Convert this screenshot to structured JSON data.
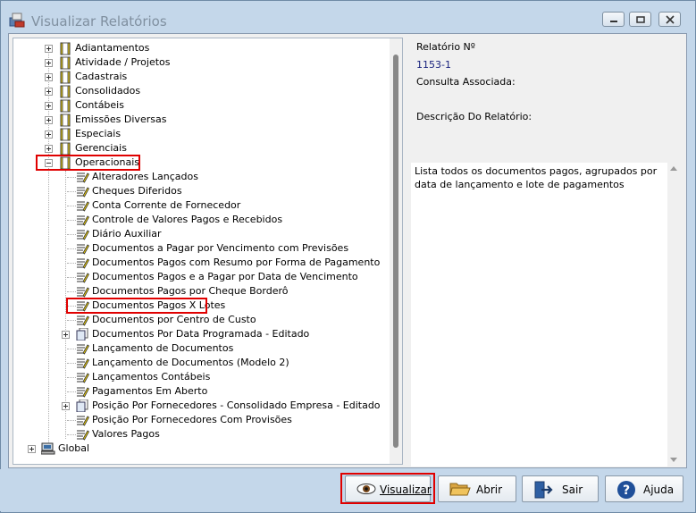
{
  "window": {
    "title": "Visualizar Relatórios"
  },
  "tree": {
    "categories": [
      "Adiantamentos",
      "Atividade / Projetos",
      "Cadastrais",
      "Consolidados",
      "Contábeis",
      "Emissões Diversas",
      "Especiais",
      "Gerenciais",
      "Operacionais"
    ],
    "reports": [
      "Alteradores Lançados",
      "Cheques Diferidos",
      "Conta Corrente de Fornecedor",
      "Controle de Valores Pagos e Recebidos",
      "Diário Auxiliar",
      "Documentos a Pagar por Vencimento com Previsões",
      "Documentos Pagos com Resumo por Forma de Pagamento",
      "Documentos Pagos e a Pagar por Data de Vencimento",
      "Documentos Pagos por Cheque Borderô",
      "Documentos Pagos X Lotes",
      "Documentos por Centro de Custo",
      "Documentos Por Data Programada - Editado",
      "Lançamento de Documentos",
      "Lançamento de Documentos (Modelo 2)",
      "Lançamentos Contábeis",
      "Pagamentos Em Aberto",
      "Posição Por Fornecedores - Consolidado Empresa - Editado",
      "Posição Por Fornecedores Com Provisões",
      "Valores Pagos"
    ],
    "root": "Global"
  },
  "details": {
    "report_number_label": "Relatório Nº",
    "report_number": "1153-1",
    "query_label": "Consulta Associada:",
    "description_label": "Descrição Do Relatório:",
    "description": "Lista todos os documentos pagos, agrupados por data de lançamento e lote de pagamentos"
  },
  "buttons": {
    "visualizar": "Visualizar",
    "abrir": "Abrir",
    "sair": "Sair",
    "ajuda": "Ajuda"
  },
  "colors": {
    "highlight": "#e00000",
    "value_text": "#1a237e",
    "frame": "#c4d7ea"
  }
}
